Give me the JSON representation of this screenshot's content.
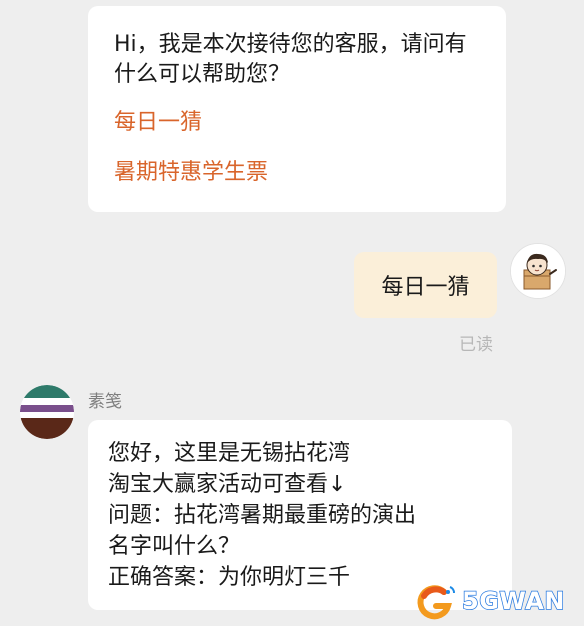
{
  "conversation": {
    "agent_greeting": {
      "text": "Hi，我是本次接待您的客服，请问有什么可以帮助您？",
      "quick_links": [
        "每日一猜",
        "暑期特惠学生票"
      ]
    },
    "user_message": {
      "text": "每日一猜",
      "status": "已读"
    },
    "agent_reply": {
      "sender_name": "素笺",
      "lines": [
        "您好，这里是无锡拈花湾",
        "淘宝大赢家活动可查看↓",
        "问题：拈花湾暑期最重磅的演出",
        "名字叫什么？",
        "正确答案：为你明灯三千"
      ]
    }
  },
  "watermark": {
    "text": "5GWAN"
  },
  "colors": {
    "background": "#eeeeee",
    "agent_bubble": "#ffffff",
    "user_bubble": "#fbefd9",
    "quick_link": "#d9652b",
    "muted_text": "#b7b7b7"
  },
  "icons": {
    "user_avatar": "cartoon-character-avatar",
    "agent_avatar": "striped-circle-avatar",
    "watermark_logo": "g-swirl-logo"
  }
}
